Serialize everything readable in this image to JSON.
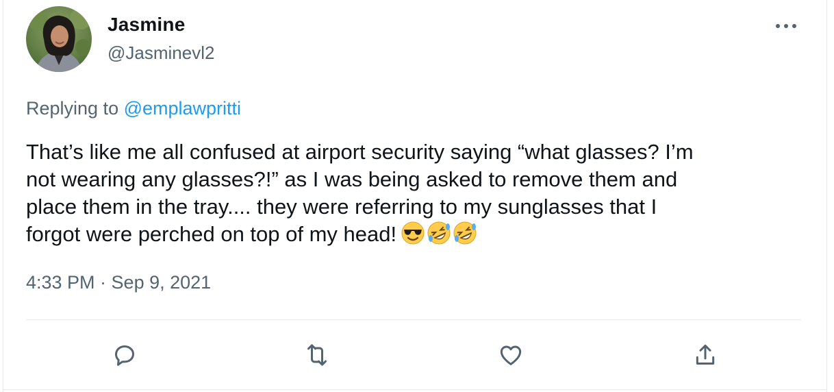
{
  "author": {
    "display_name": "Jasmine",
    "handle": "@Jasminevl2"
  },
  "reply": {
    "prefix": "Replying to ",
    "mention": "@emplawpritti"
  },
  "tweet": {
    "text": "That’s like me all confused at airport security saying “what glasses? I’m\nnot wearing any glasses?!” as I was being asked to remove them and\nplace them in the tray.... they were  referring to my sunglasses that I\nforgot were perched on top of my head!",
    "emojis": [
      "smiling-face-with-sunglasses",
      "rolling-on-the-floor-laughing",
      "rolling-on-the-floor-laughing"
    ],
    "timestamp": "4:33 PM · Sep 9, 2021"
  },
  "actions": {
    "icons": [
      "reply-icon",
      "retweet-icon",
      "like-icon",
      "share-icon"
    ]
  },
  "colors": {
    "text": "#0f1419",
    "secondary": "#536471",
    "accent": "#1d9bf0",
    "divider": "#e7e9ea"
  }
}
